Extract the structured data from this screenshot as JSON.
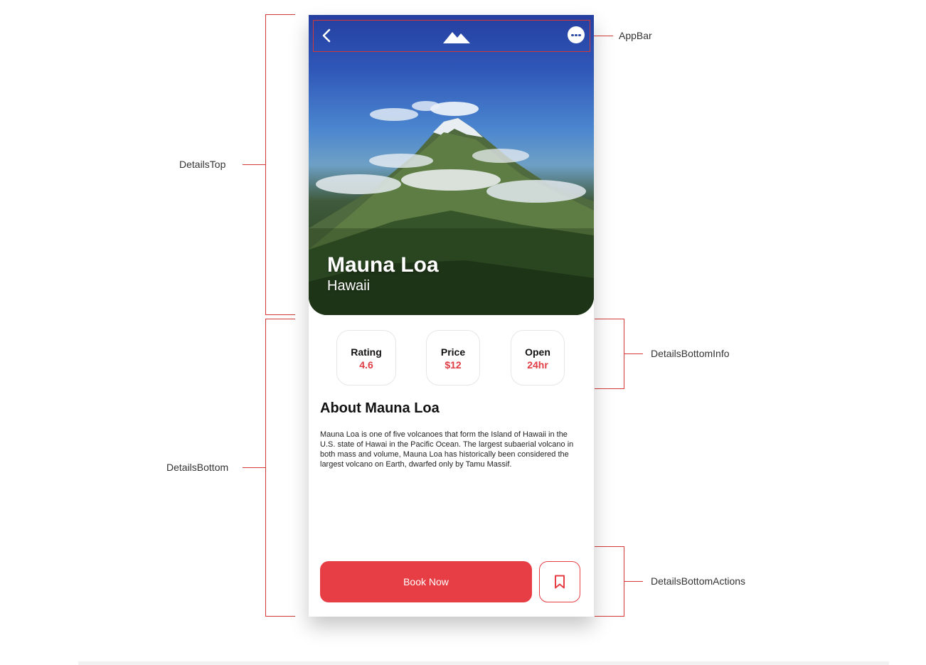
{
  "annotations": {
    "app_bar": "AppBar",
    "details_top": "DetailsTop",
    "details_bottom": "DetailsBottom",
    "details_bottom_info": "DetailsBottomInfo",
    "details_bottom_actions": "DetailsBottomActions",
    "bracket_color": "#d23a3a"
  },
  "app_bar": {
    "back_icon": "chevron-left-icon",
    "logo_icon": "mountain-logo-icon",
    "more_icon": "more-horizontal-icon"
  },
  "place": {
    "title": "Mauna Loa",
    "subtitle": "Hawaii"
  },
  "info": [
    {
      "label": "Rating",
      "value": "4.6"
    },
    {
      "label": "Price",
      "value": "$12"
    },
    {
      "label": "Open",
      "value": "24hr"
    }
  ],
  "about": {
    "title": "About Mauna Loa",
    "text": "Mauna Loa is one of five volcanoes that form the Island of Hawaii in the U.S. state of Hawai in the Pacific Ocean. The largest subaerial volcano in both mass and volume, Mauna Loa has historically been considered the largest volcano on Earth, dwarfed only by Tamu Massif."
  },
  "actions": {
    "book_label": "Book Now",
    "bookmark_icon": "bookmark-icon"
  },
  "colors": {
    "accent": "#e63e44",
    "value_text": "#e03c44"
  }
}
